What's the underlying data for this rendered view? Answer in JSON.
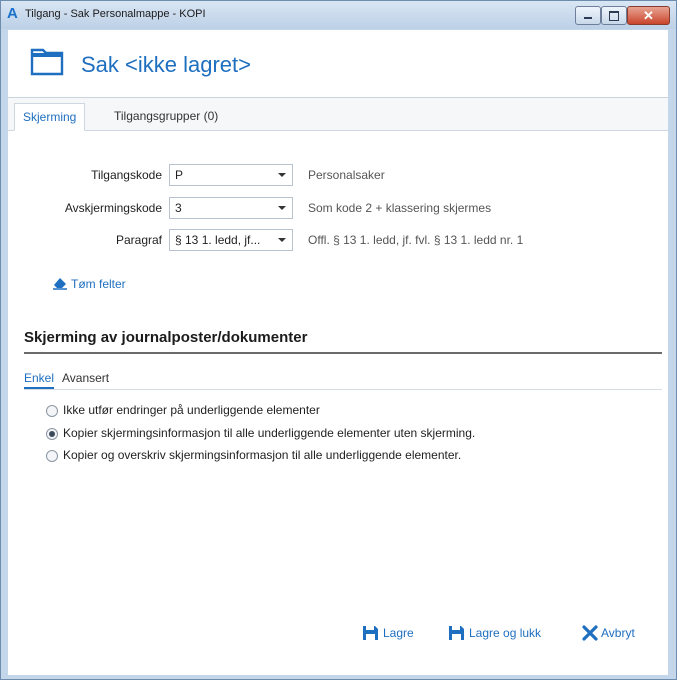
{
  "window": {
    "title": "Tilgang - Sak  Personalmappe -  KOPI",
    "app_icon": "A"
  },
  "header": {
    "title": "Sak <ikke lagret>"
  },
  "tabs": [
    {
      "label": "Skjerming"
    },
    {
      "label": "Tilgangsgrupper (0)"
    }
  ],
  "form": {
    "rows": [
      {
        "label": "Tilgangskode",
        "value": "P",
        "description": "Personalsaker"
      },
      {
        "label": "Avskjermingskode",
        "value": "3",
        "description": "Som kode 2 + klassering skjermes"
      },
      {
        "label": "Paragraf",
        "value": "§ 13 1. ledd, jf...",
        "description": "Offl. § 13 1. ledd, jf. fvl. § 13 1. ledd nr. 1"
      }
    ],
    "clear_label": "Tøm felter"
  },
  "section": {
    "title": "Skjerming av journalposter/dokumenter",
    "subtabs": [
      {
        "label": "Enkel"
      },
      {
        "label": "Avansert"
      }
    ],
    "options": [
      {
        "label": "Ikke utfør endringer på underliggende elementer",
        "checked": false
      },
      {
        "label": "Kopier skjermingsinformasjon til alle underliggende elementer uten skjerming.",
        "checked": true
      },
      {
        "label": "Kopier og overskriv skjermingsinformasjon til alle underliggende elementer.",
        "checked": false
      }
    ]
  },
  "buttons": {
    "save": "Lagre",
    "save_close": "Lagre og lukk",
    "cancel": "Avbryt"
  },
  "colors": {
    "accent": "#1e6fc0",
    "window_frame": "#c4d6ea",
    "close_button": "#c9452c"
  },
  "icons": {
    "app": "app-logo-icon",
    "folder": "folder-icon",
    "clear": "eraser-icon",
    "save": "save-icon",
    "save_close": "save-icon",
    "cancel": "close-x-icon"
  }
}
